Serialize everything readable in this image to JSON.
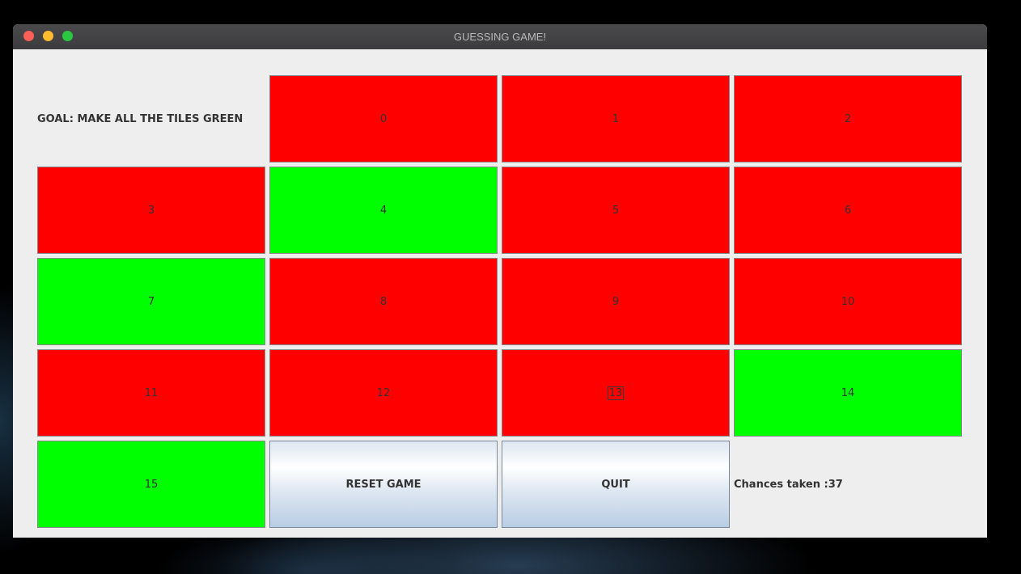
{
  "window": {
    "title": "GUESSING GAME!"
  },
  "goal_label": "GOAL: MAKE ALL THE TILES GREEN",
  "tiles": [
    {
      "label": "0",
      "state": "red"
    },
    {
      "label": "1",
      "state": "red"
    },
    {
      "label": "2",
      "state": "red"
    },
    {
      "label": "3",
      "state": "red"
    },
    {
      "label": "4",
      "state": "green"
    },
    {
      "label": "5",
      "state": "red"
    },
    {
      "label": "6",
      "state": "red"
    },
    {
      "label": "7",
      "state": "green"
    },
    {
      "label": "8",
      "state": "red"
    },
    {
      "label": "9",
      "state": "red"
    },
    {
      "label": "10",
      "state": "red"
    },
    {
      "label": "11",
      "state": "red"
    },
    {
      "label": "12",
      "state": "red"
    },
    {
      "label": "13",
      "state": "red",
      "focused": true
    },
    {
      "label": "14",
      "state": "green"
    },
    {
      "label": "15",
      "state": "green"
    }
  ],
  "buttons": {
    "reset_label": "RESET GAME",
    "quit_label": "QUIT"
  },
  "chances_label": "Chances taken :37",
  "colors": {
    "red_tile": "#ff0000",
    "green_tile": "#00ff00",
    "window_bg": "#eeeeee"
  }
}
